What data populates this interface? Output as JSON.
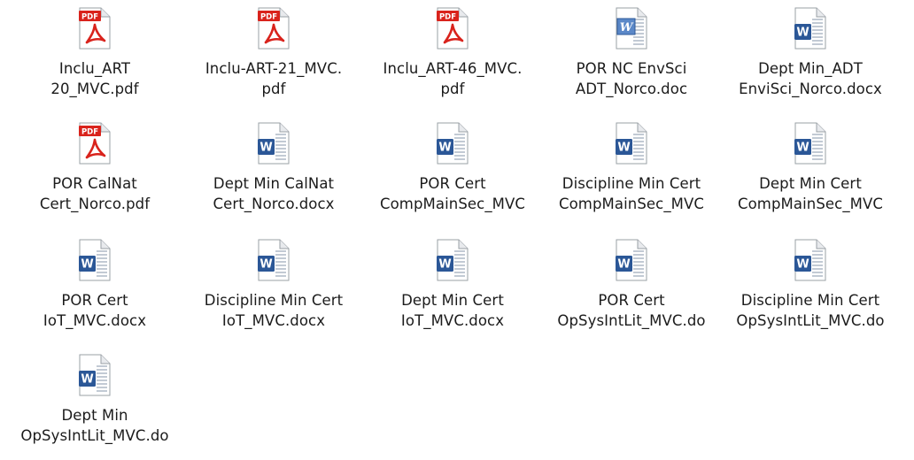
{
  "files": [
    {
      "icon": "pdf-file-icon",
      "line1": "Inclu_ART",
      "line2": "20_MVC.pdf"
    },
    {
      "icon": "pdf-file-icon",
      "line1": "Inclu-ART-21_MVC.",
      "line2": "pdf"
    },
    {
      "icon": "pdf-file-icon",
      "line1": "Inclu_ART-46_MVC.",
      "line2": "pdf"
    },
    {
      "icon": "word-legacy-file-icon",
      "line1": "POR NC EnvSci",
      "line2": "ADT_Norco.doc"
    },
    {
      "icon": "word-file-icon",
      "line1": "Dept Min_ADT",
      "line2": "EnviSci_Norco.docx"
    },
    {
      "icon": "pdf-file-icon",
      "line1": "POR CalNat",
      "line2": "Cert_Norco.pdf"
    },
    {
      "icon": "word-file-icon",
      "line1": "Dept Min CalNat",
      "line2": "Cert_Norco.docx"
    },
    {
      "icon": "word-file-icon",
      "line1": "POR Cert",
      "line2": "CompMainSec_MVC"
    },
    {
      "icon": "word-file-icon",
      "line1": "Discipline Min Cert",
      "line2": "CompMainSec_MVC"
    },
    {
      "icon": "word-file-icon",
      "line1": "Dept Min Cert",
      "line2": "CompMainSec_MVC"
    },
    {
      "icon": "word-file-icon",
      "line1": "POR Cert",
      "line2": "IoT_MVC.docx"
    },
    {
      "icon": "word-file-icon",
      "line1": "Discipline Min Cert",
      "line2": "IoT_MVC.docx"
    },
    {
      "icon": "word-file-icon",
      "line1": "Dept Min Cert",
      "line2": "IoT_MVC.docx"
    },
    {
      "icon": "word-file-icon",
      "line1": "POR Cert",
      "line2": "OpSysIntLit_MVC.do"
    },
    {
      "icon": "word-file-icon",
      "line1": "Discipline Min Cert",
      "line2": "OpSysIntLit_MVC.do"
    },
    {
      "icon": "word-file-icon",
      "line1": "Dept Min",
      "line2": "OpSysIntLit_MVC.do"
    }
  ],
  "icon_text": {
    "pdf_badge": "PDF",
    "word_badge": "W"
  },
  "colors": {
    "pdf_red": "#d9231c",
    "word_blue": "#2b5797",
    "page_border": "#9aa0a6",
    "page_fold": "#e8eaed"
  }
}
